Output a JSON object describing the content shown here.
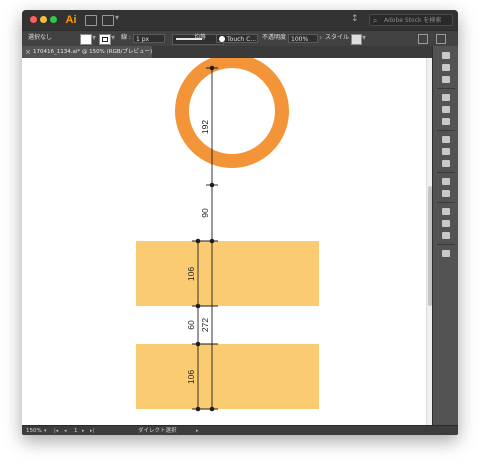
{
  "app": {
    "logo": "Ai"
  },
  "titlebar": {
    "search_placeholder": "Adobe Stock を検索",
    "arrange_label": "↕"
  },
  "control_bar": {
    "selection_label": "選択なし",
    "stroke_label": "線 :",
    "stroke_weight": "1 px",
    "stroke_profile": "均等",
    "brush_name": "Touch C...",
    "opacity_label": "不透明度",
    "opacity_value": "100%",
    "style_label": "スタイル :"
  },
  "document": {
    "tab_title": "170416_1134.ai* @ 150% (RGB/プレビュー)"
  },
  "status_bar": {
    "zoom": "150%",
    "page_number": "1",
    "tool_name": "ダイレクト選択"
  },
  "artwork": {
    "colors": {
      "ring": "#f29437",
      "rectangles": "#fbcb72",
      "measure_line": "#1e1e1e"
    },
    "measurements": {
      "circle_diameter": "192",
      "gap_circle_to_rect": "90",
      "rect_top_height": "106",
      "gap_between_rects": "60",
      "rect_bottom_height": "106",
      "total_span": "272"
    }
  },
  "icons": {
    "close": "close-icon",
    "search": "search-icon",
    "chevron": "chevron-down-icon"
  }
}
